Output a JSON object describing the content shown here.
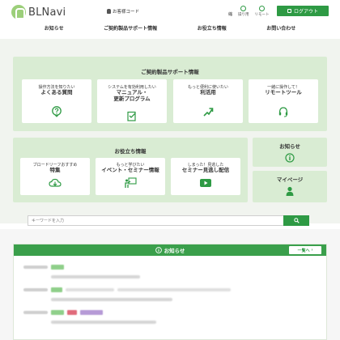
{
  "header": {
    "logo_text": "BLNavi",
    "customer_code": "お客様コード",
    "font_size_label": "縮",
    "mini_links": [
      "操り用",
      "リモート"
    ],
    "logout_label": "ログアウト"
  },
  "gnav": [
    "お知らせ",
    "ご契約製品サポート情報",
    "お役立ち情報",
    "お問い合わせ"
  ],
  "support": {
    "title": "ご契約製品サポート情報",
    "cards": [
      {
        "sub": "操作方法を知りたい",
        "main": "よくある質問",
        "icon": "question-icon"
      },
      {
        "sub": "システムを有効利用したい",
        "main": "マニュアル・\n更新プログラム",
        "icon": "checklist-icon"
      },
      {
        "sub": "もっと便利に使いたい",
        "main": "利活用",
        "icon": "arrow-up-icon"
      },
      {
        "sub": "一緒に操作して！",
        "main": "リモートツール",
        "icon": "headset-icon"
      }
    ]
  },
  "useful": {
    "title": "お役立ち情報",
    "cards": [
      {
        "sub": "ブロードリーフおすすめ",
        "main": "特集",
        "icon": "download-cloud-icon"
      },
      {
        "sub": "もっと学びたい",
        "main": "イベント・セミナー情報",
        "icon": "presentation-icon"
      },
      {
        "sub": "しまった！見逃した",
        "main": "セミナー見逃し配信",
        "icon": "play-icon"
      }
    ]
  },
  "side": {
    "news_label": "お知らせ",
    "mypage_label": "マイページ"
  },
  "search": {
    "placeholder": "キーワードを入力"
  },
  "news": {
    "title": "お知らせ",
    "all_label": "一覧へ"
  },
  "colors": {
    "brand_green": "#2e9a44",
    "panel_green": "#d9ecd3",
    "tag_red": "#e06a7a",
    "tag_purple": "#b69ad6",
    "tag_green": "#8fcf8a"
  }
}
